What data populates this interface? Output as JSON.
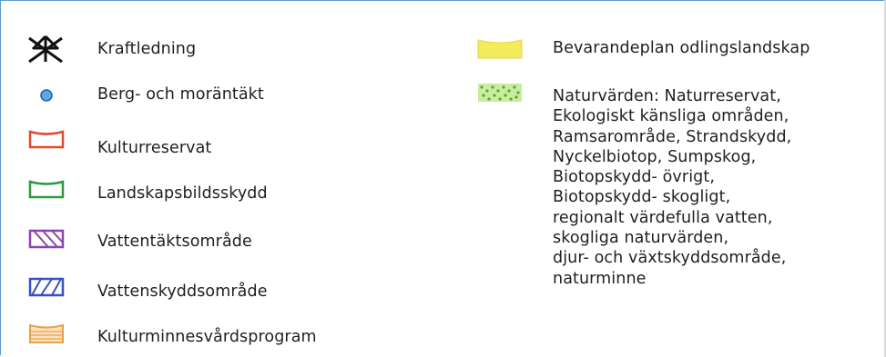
{
  "legend": {
    "left_items": [
      {
        "symbol": "kraftledning-icon",
        "label": "Kraftledning"
      },
      {
        "symbol": "blue-dot-icon",
        "label": "Berg- och moräntäkt"
      },
      {
        "symbol": "red-outline-icon",
        "label": "Kulturreservat"
      },
      {
        "symbol": "green-outline-icon",
        "label": "Landskapsbildsskydd"
      },
      {
        "symbol": "purple-hatch-icon",
        "label": "Vattentäktsområde"
      },
      {
        "symbol": "blue-hatch-icon",
        "label": "Vattenskyddsområde"
      },
      {
        "symbol": "orange-lined-icon",
        "label": "Kulturminnesvårdsprogram"
      }
    ],
    "right_items": [
      {
        "symbol": "yellow-fill-icon",
        "label": "Bevarandeplan odlingslandskap"
      },
      {
        "symbol": "green-dotted-icon",
        "lines": [
          "Naturvärden: Naturreservat,",
          "Ekologiskt känsliga områden,",
          "Ramsarområde, Strandskydd,",
          "Nyckelbiotop, Sumpskog,",
          "Biotopskydd- övrigt,",
          "Biotopskydd- skogligt,",
          "regionalt värdefulla vatten,",
          "skogliga naturvärden,",
          "djur- och växtskyddsområde,",
          "naturminne"
        ]
      }
    ]
  },
  "colors": {
    "frame": "#5b9bd5",
    "blue_dot": "#5aa9e6",
    "red_outline": "#e04b2a",
    "green_outline": "#2f9a3c",
    "purple_hatch": "#8e44ad",
    "blue_hatch": "#3a4fc4",
    "orange_lined": "#e8a04a",
    "yellow_fill": "#f3ea5c",
    "green_dotted": "#7cc44a"
  }
}
